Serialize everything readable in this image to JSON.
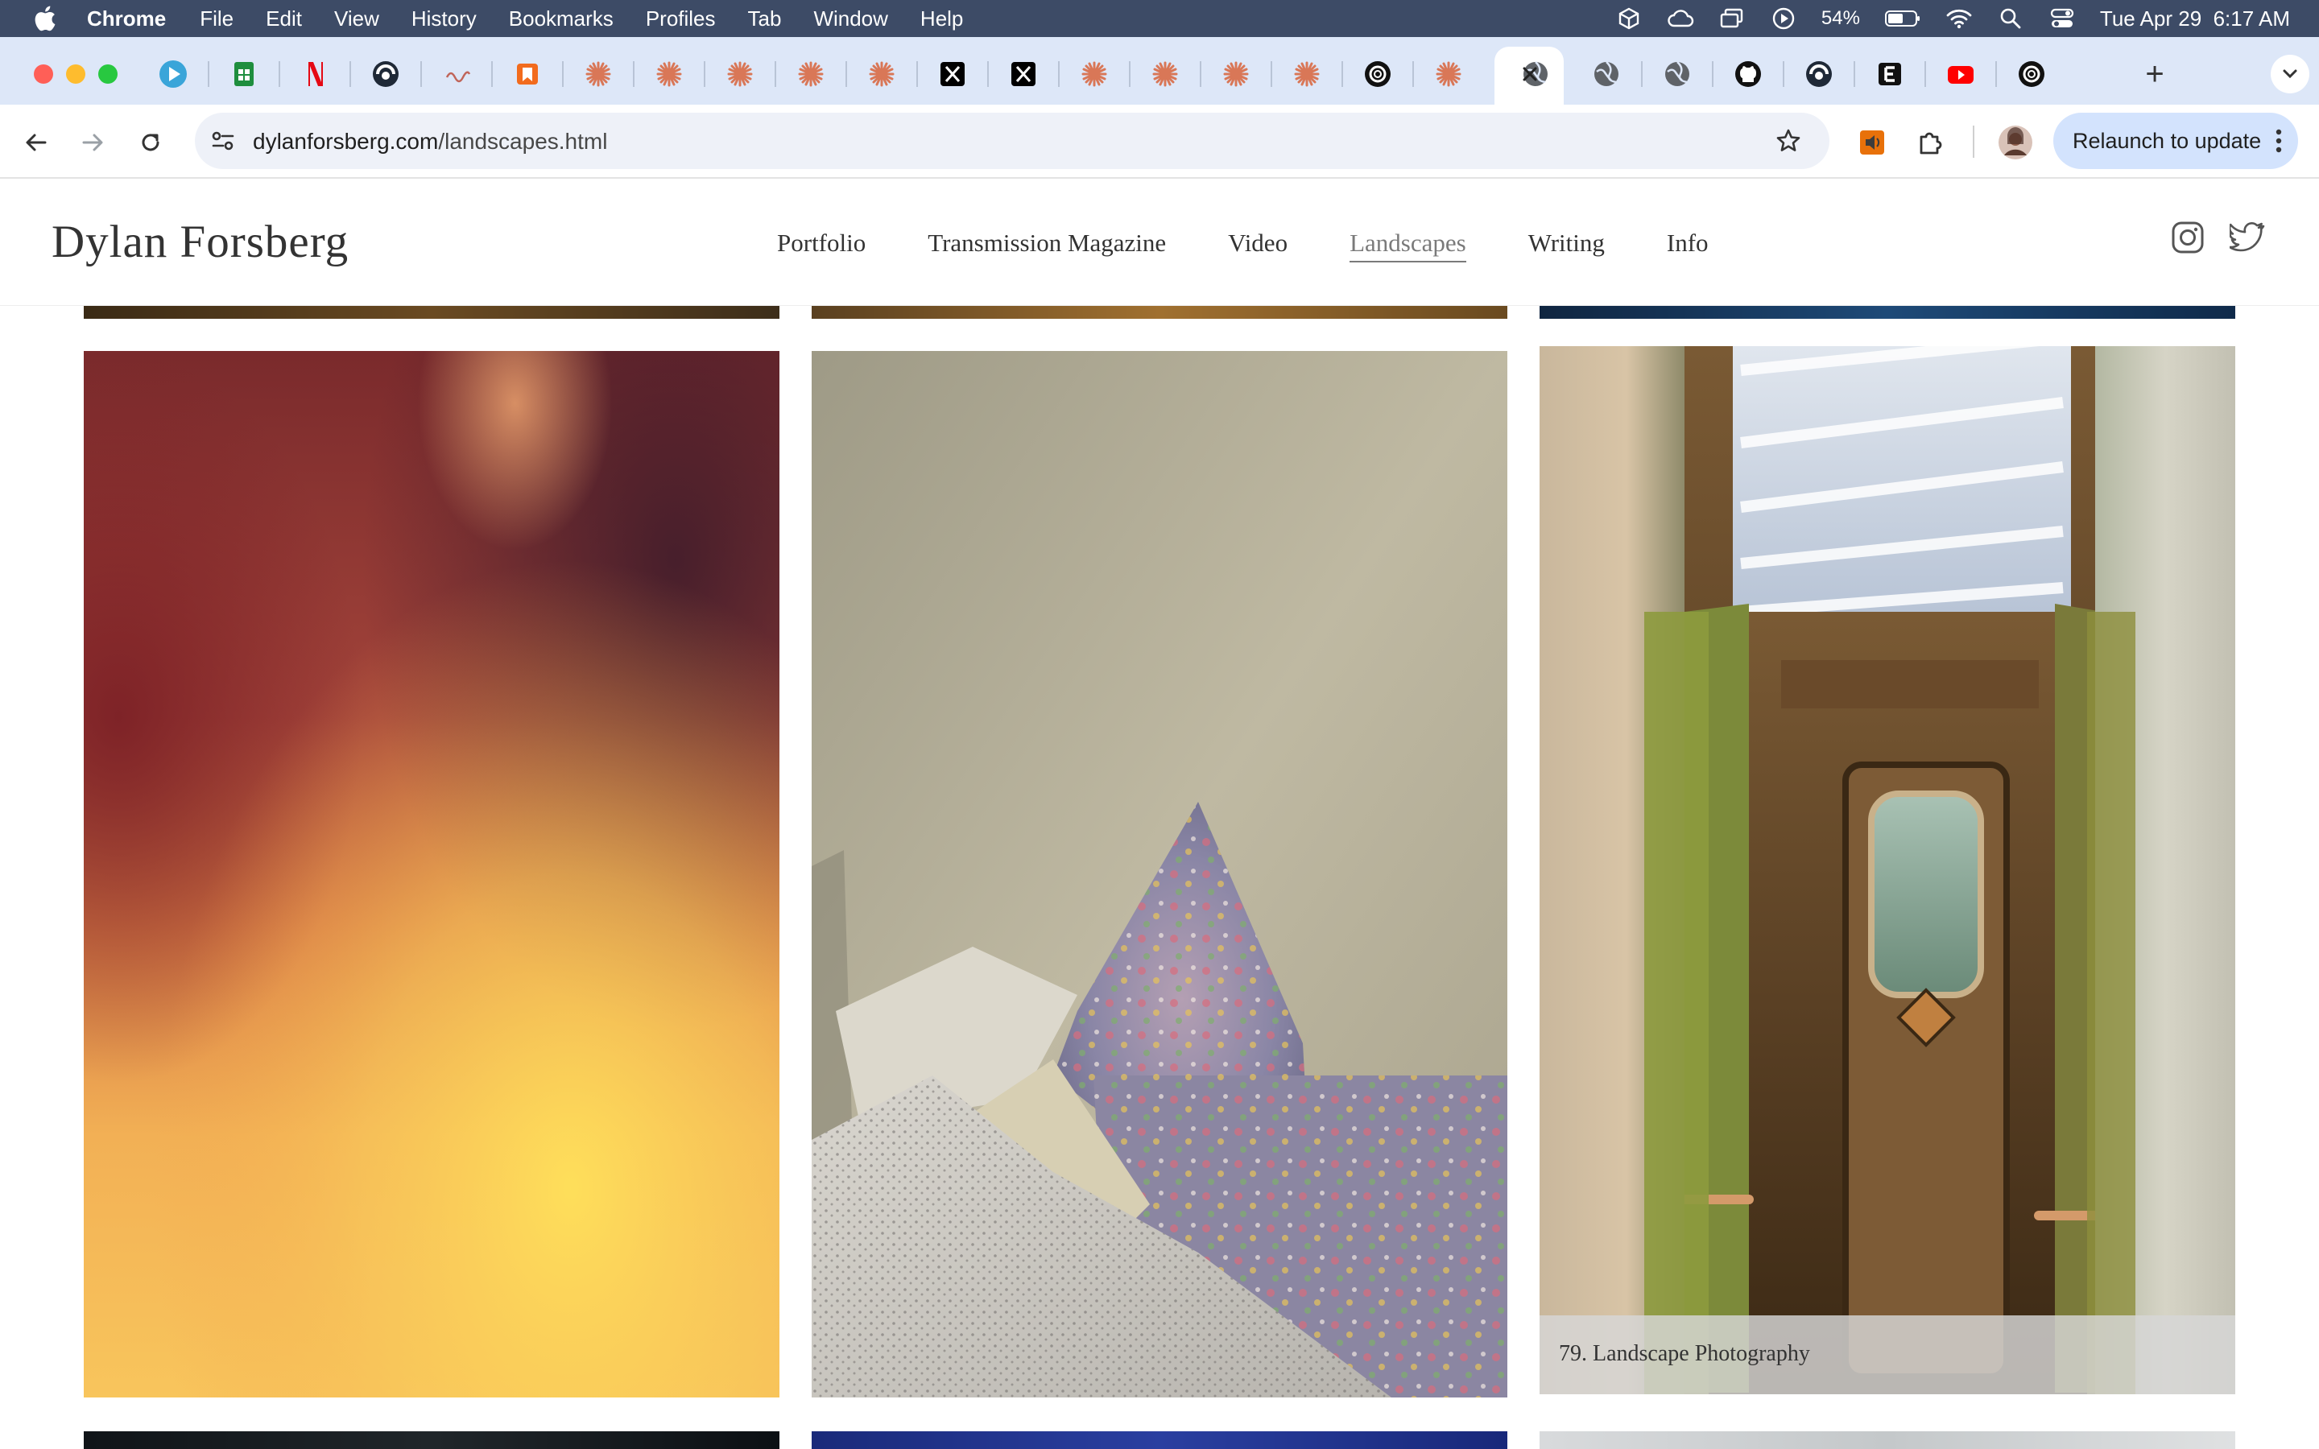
{
  "menubar": {
    "app_name": "Chrome",
    "items": [
      "File",
      "Edit",
      "View",
      "History",
      "Bookmarks",
      "Profiles",
      "Tab",
      "Window",
      "Help"
    ],
    "battery": "54%",
    "datetime": "Tue Apr 29  6:17 AM"
  },
  "tabs": {
    "favicons": [
      "media-player-icon",
      "sheets-icon",
      "netflix-icon",
      "app-icon",
      "wave-icon",
      "bookmark-icon",
      "claude-icon",
      "claude-icon",
      "claude-icon",
      "claude-icon",
      "claude-icon",
      "x-icon",
      "x-icon",
      "claude-icon",
      "claude-icon",
      "claude-icon",
      "claude-icon",
      "openai-icon",
      "claude-icon",
      "globe-icon",
      "globe-icon",
      "globe-icon",
      "github-icon",
      "app-icon",
      "e-icon",
      "youtube-icon",
      "openai-icon"
    ],
    "new_tab_symbol": "+"
  },
  "toolbar": {
    "url_domain": "dylanforsberg.com",
    "url_path": "/landscapes.html",
    "relaunch_label": "Relaunch to update"
  },
  "site": {
    "title": "Dylan Forsberg",
    "nav": [
      "Portfolio",
      "Transmission Magazine",
      "Video",
      "Landscapes",
      "Writing",
      "Info"
    ],
    "active_nav": "Landscapes"
  },
  "gallery": {
    "caption": "79. Landscape Photography"
  },
  "colors": {
    "menubar_bg": "#3d4b66",
    "tabstrip_bg": "#dde7f8",
    "relaunch_bg": "#d3e3fd",
    "claude_orange": "#d97757"
  }
}
